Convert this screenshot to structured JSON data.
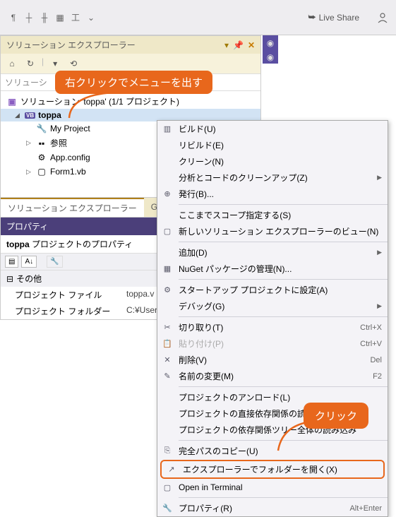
{
  "toolbar": {
    "icons": [
      "align-left",
      "align-h",
      "align-v",
      "align-distribute",
      "format"
    ],
    "live_share": "Live Share"
  },
  "panel": {
    "title": "ソリューション エクスプローラー",
    "search_placeholder": "ソリューシ",
    "solution_label": "ソリューション 'toppa' (1/1 プロジェクト)",
    "project": "toppa",
    "nodes": {
      "my_project": "My Project",
      "refs": "参照",
      "app_config": "App.config",
      "form1": "Form1.vb"
    },
    "tabs": {
      "explorer": "ソリューション エクスプローラー",
      "git": "Git 変更"
    }
  },
  "props": {
    "title": "プロパティ",
    "subtitle": "toppa プロジェクトのプロパティ",
    "cat": "その他",
    "rows": [
      {
        "k": "プロジェクト ファイル",
        "v": "toppa.v"
      },
      {
        "k": "プロジェクト フォルダー",
        "v": "C:¥User"
      }
    ]
  },
  "ctx": {
    "build": "ビルド(U)",
    "rebuild": "リビルド(E)",
    "clean": "クリーン(N)",
    "analysis": "分析とコードのクリーンアップ(Z)",
    "publish": "発行(B)...",
    "scope": "ここまでスコープ指定する(S)",
    "new_view": "新しいソリューション エクスプローラーのビュー(N)",
    "add": "追加(D)",
    "nuget": "NuGet パッケージの管理(N)...",
    "startup": "スタートアップ プロジェクトに設定(A)",
    "debug": "デバッグ(G)",
    "cut": "切り取り(T)",
    "paste": "貼り付け(P)",
    "delete": "削除(V)",
    "rename": "名前の変更(M)",
    "unload": "プロジェクトのアンロード(L)",
    "dep_load": "プロジェクトの直接依存関係の読み込み",
    "dep_tree": "プロジェクトの依存関係ツリー全体の読み込み",
    "copy_path": "完全パスのコピー(U)",
    "open_explorer": "エクスプローラーでフォルダーを開く(X)",
    "open_terminal": "Open in Terminal",
    "properties": "プロパティ(R)",
    "keys": {
      "cut": "Ctrl+X",
      "paste": "Ctrl+V",
      "delete": "Del",
      "rename": "F2",
      "props": "Alt+Enter"
    }
  },
  "callouts": {
    "right_click": "右クリックでメニューを出す",
    "click": "クリック"
  }
}
